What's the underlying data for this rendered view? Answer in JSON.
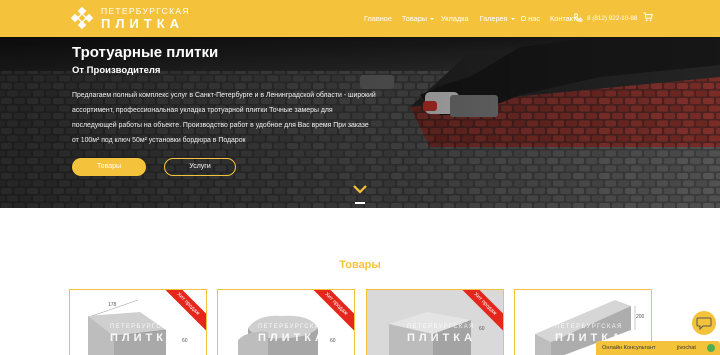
{
  "colors": {
    "accent": "#f5c33b",
    "ribbon": "#e4261c",
    "online": "#4caf50"
  },
  "header": {
    "logo_line1": "ПЕТЕРБУРГСКАЯ",
    "logo_line2": "ПЛИТКА",
    "nav": [
      {
        "label": "Главное"
      },
      {
        "label": "Товары"
      },
      {
        "label": "Укладка"
      },
      {
        "label": "Галерея"
      },
      {
        "label": "О нас"
      },
      {
        "label": "Контакты"
      }
    ],
    "phone": "8 (812) 922-10-88",
    "phone_icon": "phone-icon",
    "cart_icon": "cart-icon"
  },
  "hero": {
    "title": "Тротуарные плитки",
    "subtitle": "От Производителя",
    "text": "Предлагаем полный комплекс услуг в Санкт-Петербурге и в Ленинградской области - широкий ассортимент, профессиональная укладка тротуарной плитки Точные замеры для последующей работы на объекте. Производство работ в удобное для Вас время При заказе от 100м² под ключ 50м² установки бордюра в Подарок",
    "button_primary": "Товары",
    "button_secondary": "Услуги",
    "scroll_icon": "chevron-down-icon"
  },
  "products": {
    "title": "Товары",
    "ribbon": "Хит продаж",
    "watermark_line1": "ПЕТЕРБУРГСКАЯ",
    "watermark_line2": "ПЛИТКА",
    "cards": [
      {
        "dim_a": "178",
        "dim_b": "60"
      },
      {
        "dim_a": "60"
      },
      {
        "dim_a": "60"
      },
      {
        "dim_a": "200"
      }
    ]
  },
  "chat": {
    "label": "Онлайн Консультант",
    "brand": "jivochat",
    "chat_icon": "chat-bubble-icon"
  }
}
